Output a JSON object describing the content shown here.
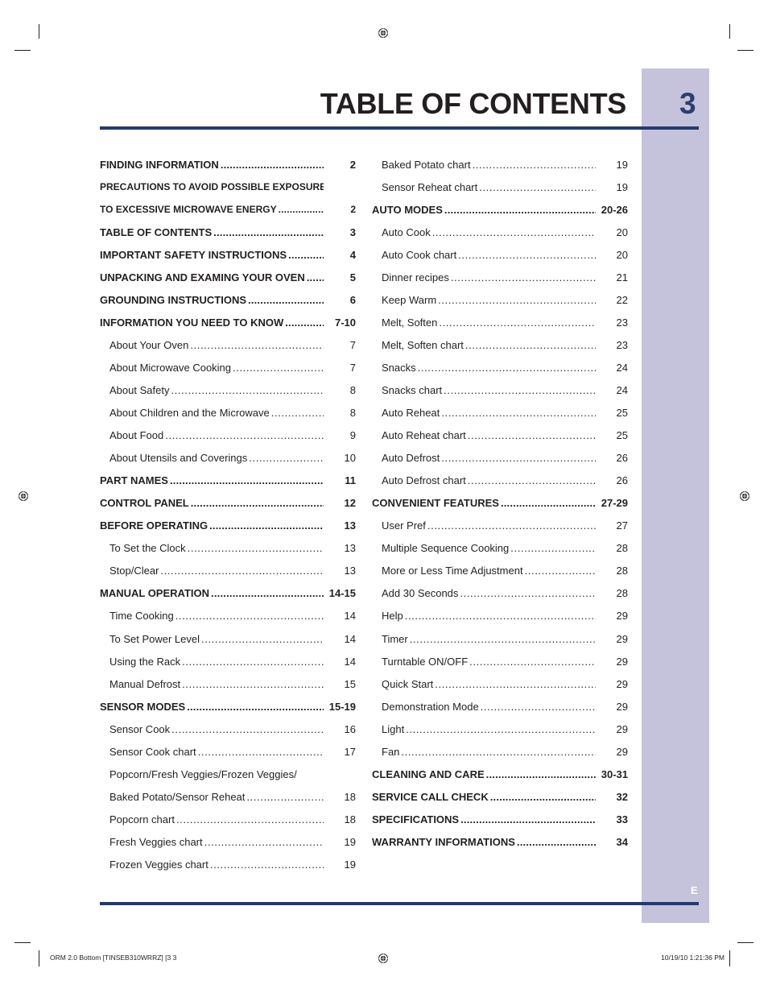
{
  "header": {
    "title": "TABLE OF CONTENTS",
    "page_number": "3",
    "language_tab": "E"
  },
  "colors": {
    "accent_navy": "#253a6b",
    "tab_lavender": "#c5c3dc",
    "text": "#231f20"
  },
  "toc": {
    "left": [
      {
        "label": "FINDING INFORMATION",
        "page": "2",
        "level": "main",
        "leader": true
      },
      {
        "label": "PRECAUTIONS TO AVOID POSSIBLE EXPOSURE",
        "page": "",
        "level": "main-small",
        "leader": false
      },
      {
        "label": "TO EXCESSIVE MICROWAVE ENERGY",
        "page": "2",
        "level": "main-small",
        "leader": true
      },
      {
        "label": "TABLE OF CONTENTS",
        "page": "3",
        "level": "main",
        "leader": true
      },
      {
        "label": "IMPORTANT SAFETY INSTRUCTIONS",
        "page": "4",
        "level": "main",
        "leader": true
      },
      {
        "label": "UNPACKING AND EXAMING YOUR OVEN",
        "page": "5",
        "level": "main",
        "leader": true
      },
      {
        "label": "GROUNDING INSTRUCTIONS",
        "page": "6",
        "level": "main",
        "leader": true
      },
      {
        "label": "INFORMATION YOU NEED TO KNOW",
        "page": "7-10",
        "level": "main",
        "leader": true
      },
      {
        "label": "About Your Oven",
        "page": "7",
        "level": "sub",
        "leader": true
      },
      {
        "label": "About Microwave Cooking",
        "page": "7",
        "level": "sub",
        "leader": true
      },
      {
        "label": "About Safety",
        "page": "8",
        "level": "sub",
        "leader": true
      },
      {
        "label": "About Children and the Microwave",
        "page": "8",
        "level": "sub",
        "leader": true
      },
      {
        "label": "About Food",
        "page": "9",
        "level": "sub",
        "leader": true
      },
      {
        "label": "About Utensils and Coverings",
        "page": "10",
        "level": "sub",
        "leader": true
      },
      {
        "label": "PART NAMES",
        "page": "11",
        "level": "main",
        "leader": true
      },
      {
        "label": "CONTROL PANEL",
        "page": "12",
        "level": "main",
        "leader": true
      },
      {
        "label": "BEFORE OPERATING",
        "page": "13",
        "level": "main",
        "leader": true
      },
      {
        "label": "To Set the Clock",
        "page": "13",
        "level": "sub",
        "leader": true
      },
      {
        "label": "Stop/Clear",
        "page": "13",
        "level": "sub",
        "leader": true
      },
      {
        "label": "MANUAL OPERATION",
        "page": "14-15",
        "level": "main",
        "leader": true
      },
      {
        "label": "Time Cooking",
        "page": "14",
        "level": "sub",
        "leader": true
      },
      {
        "label": "To Set Power Level",
        "page": "14",
        "level": "sub",
        "leader": true
      },
      {
        "label": "Using the Rack",
        "page": "14",
        "level": "sub",
        "leader": true
      },
      {
        "label": "Manual Defrost",
        "page": "15",
        "level": "sub",
        "leader": true
      },
      {
        "label": "SENSOR MODES",
        "page": "15-19",
        "level": "main",
        "leader": true
      },
      {
        "label": "Sensor Cook",
        "page": "16",
        "level": "sub",
        "leader": true
      },
      {
        "label": "Sensor Cook chart",
        "page": "17",
        "level": "sub",
        "leader": true
      },
      {
        "label": "Popcorn/Fresh Veggies/Frozen Veggies/",
        "page": "",
        "level": "sub",
        "leader": false
      },
      {
        "label": "Baked Potato/Sensor Reheat",
        "page": "18",
        "level": "sub",
        "leader": true
      },
      {
        "label": "Popcorn chart",
        "page": "18",
        "level": "sub",
        "leader": true
      },
      {
        "label": "Fresh Veggies chart",
        "page": "19",
        "level": "sub",
        "leader": true
      },
      {
        "label": "Frozen Veggies chart",
        "page": "19",
        "level": "sub",
        "leader": true
      }
    ],
    "right": [
      {
        "label": "Baked Potato chart",
        "page": "19",
        "level": "sub",
        "leader": true
      },
      {
        "label": "Sensor Reheat chart",
        "page": "19",
        "level": "sub",
        "leader": true
      },
      {
        "label": "AUTO MODES",
        "page": "20-26",
        "level": "main",
        "leader": true
      },
      {
        "label": "Auto Cook",
        "page": "20",
        "level": "sub",
        "leader": true
      },
      {
        "label": "Auto Cook chart",
        "page": "20",
        "level": "sub",
        "leader": true
      },
      {
        "label": "Dinner recipes",
        "page": "21",
        "level": "sub",
        "leader": true
      },
      {
        "label": "Keep Warm",
        "page": "22",
        "level": "sub",
        "leader": true
      },
      {
        "label": "Melt, Soften",
        "page": "23",
        "level": "sub",
        "leader": true
      },
      {
        "label": "Melt, Soften chart",
        "page": "23",
        "level": "sub",
        "leader": true
      },
      {
        "label": "Snacks",
        "page": "24",
        "level": "sub",
        "leader": true
      },
      {
        "label": "Snacks chart",
        "page": "24",
        "level": "sub",
        "leader": true
      },
      {
        "label": "Auto Reheat",
        "page": "25",
        "level": "sub",
        "leader": true
      },
      {
        "label": "Auto Reheat chart",
        "page": "25",
        "level": "sub",
        "leader": true
      },
      {
        "label": "Auto Defrost",
        "page": "26",
        "level": "sub",
        "leader": true
      },
      {
        "label": "Auto Defrost chart",
        "page": "26",
        "level": "sub",
        "leader": true
      },
      {
        "label": "CONVENIENT FEATURES",
        "page": "27-29",
        "level": "main",
        "leader": true
      },
      {
        "label": "User Pref",
        "page": "27",
        "level": "sub",
        "leader": true
      },
      {
        "label": "Multiple Sequence Cooking",
        "page": "28",
        "level": "sub",
        "leader": true
      },
      {
        "label": "More or Less Time Adjustment",
        "page": "28",
        "level": "sub",
        "leader": true
      },
      {
        "label": "Add 30 Seconds",
        "page": "28",
        "level": "sub",
        "leader": true
      },
      {
        "label": "Help",
        "page": "29",
        "level": "sub",
        "leader": true
      },
      {
        "label": "Timer",
        "page": "29",
        "level": "sub",
        "leader": true
      },
      {
        "label": "Turntable ON/OFF",
        "page": "29",
        "level": "sub",
        "leader": true
      },
      {
        "label": "Quick Start",
        "page": "29",
        "level": "sub",
        "leader": true
      },
      {
        "label": "Demonstration Mode",
        "page": "29",
        "level": "sub",
        "leader": true
      },
      {
        "label": "Light",
        "page": "29",
        "level": "sub",
        "leader": true
      },
      {
        "label": "Fan",
        "page": "29",
        "level": "sub",
        "leader": true
      },
      {
        "label": "CLEANING AND CARE",
        "page": "30-31",
        "level": "main",
        "leader": true
      },
      {
        "label": "SERVICE CALL CHECK",
        "page": "32",
        "level": "main",
        "leader": true
      },
      {
        "label": "SPECIFICATIONS",
        "page": "33",
        "level": "main",
        "leader": true
      },
      {
        "label": "WARRANTY INFORMATIONS",
        "page": "34",
        "level": "main",
        "leader": true
      }
    ]
  },
  "footer": {
    "file_info": "ORM 2.0 Bottom [TINSEB310WRRZ] [3   3",
    "timestamp": "10/19/10   1:21:36 PM"
  },
  "icons": {
    "registration_mark": "registration-mark-icon"
  }
}
